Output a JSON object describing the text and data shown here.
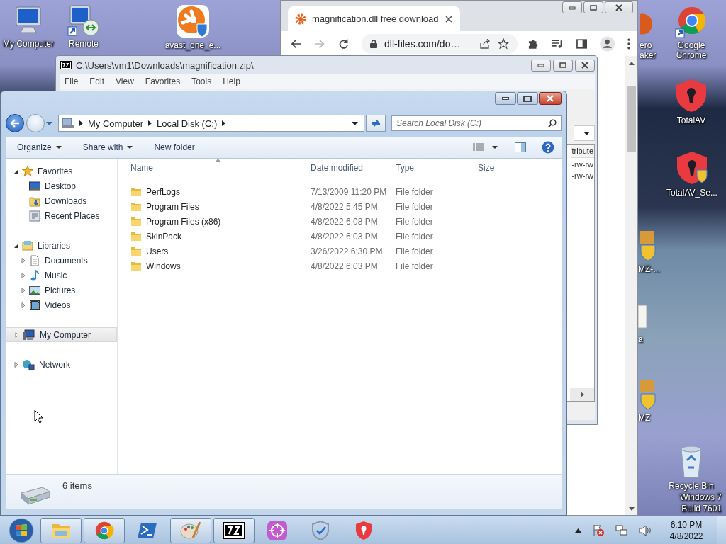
{
  "desktop": {
    "left_icons": [
      {
        "label": "My Computer",
        "kind": "computer"
      },
      {
        "label": "Remote",
        "kind": "remote"
      },
      {
        "label": "avast_one_e...",
        "kind": "avast"
      }
    ],
    "right_icons": [
      {
        "label": "ero aker",
        "kind": "partial"
      },
      {
        "label": "Google Chrome",
        "kind": "chrome"
      },
      {
        "label": "TotalAV",
        "kind": "totalav"
      },
      {
        "label": "TotalAV_Se...",
        "kind": "totalav-setup"
      },
      {
        "label": "MZ-...",
        "kind": "installer"
      },
      {
        "label": "a",
        "kind": "document"
      },
      {
        "label": "MZ",
        "kind": "installer"
      },
      {
        "label": "Recycle Bin",
        "kind": "recycle"
      }
    ],
    "os_label": [
      "Windows 7",
      "Build 7601"
    ]
  },
  "browser": {
    "tab": {
      "title": "magnification.dll free download",
      "selected": true
    },
    "address": "dll-files.com/do…"
  },
  "archive_window": {
    "title": "C:\\Users\\vm1\\Downloads\\magnification.zip\\",
    "menu": [
      "File",
      "Edit",
      "View",
      "Favorites",
      "Tools",
      "Help"
    ],
    "column_header": "tribute",
    "rows": [
      "-rw-rw",
      "-rw-rw"
    ]
  },
  "explorer": {
    "breadcrumb": [
      "My Computer",
      "Local Disk (C:)"
    ],
    "search": {
      "placeholder": "Search Local Disk (C:)"
    },
    "commands": [
      {
        "label": "Organize",
        "dropdown": true
      },
      {
        "label": "Share with",
        "dropdown": true
      },
      {
        "label": "New folder",
        "dropdown": false
      }
    ],
    "tree": [
      {
        "label": "Favorites",
        "kind": "star",
        "expanded": true,
        "selected": false,
        "children": [
          {
            "label": "Desktop",
            "kind": "desktop",
            "selected": false
          },
          {
            "label": "Downloads",
            "kind": "downloads",
            "selected": false
          },
          {
            "label": "Recent Places",
            "kind": "recent",
            "selected": false
          }
        ]
      },
      {
        "label": "Libraries",
        "kind": "library",
        "expanded": true,
        "selected": false,
        "children": [
          {
            "label": "Documents",
            "kind": "documents",
            "expanded": false,
            "selected": false
          },
          {
            "label": "Music",
            "kind": "music",
            "expanded": false,
            "selected": false
          },
          {
            "label": "Pictures",
            "kind": "pictures",
            "expanded": false,
            "selected": false
          },
          {
            "label": "Videos",
            "kind": "videos",
            "expanded": false,
            "selected": false
          }
        ]
      },
      {
        "label": "My Computer",
        "kind": "computer",
        "expanded": false,
        "selected": true
      },
      {
        "label": "Network",
        "kind": "network",
        "expanded": false,
        "selected": false
      }
    ],
    "columns": [
      "Name",
      "Date modified",
      "Type",
      "Size"
    ],
    "files": [
      {
        "name": "PerfLogs",
        "date": "7/13/2009 11:20 PM",
        "type": "File folder"
      },
      {
        "name": "Program Files",
        "date": "4/8/2022 5:45 PM",
        "type": "File folder"
      },
      {
        "name": "Program Files (x86)",
        "date": "4/8/2022 6:08 PM",
        "type": "File folder"
      },
      {
        "name": "SkinPack",
        "date": "4/8/2022 6:03 PM",
        "type": "File folder"
      },
      {
        "name": "Users",
        "date": "3/26/2022 6:30 PM",
        "type": "File folder"
      },
      {
        "name": "Windows",
        "date": "4/8/2022 6:03 PM",
        "type": "File folder"
      }
    ],
    "status": "6 items"
  },
  "taskbar": {
    "apps": [
      {
        "kind": "explorer",
        "running": true
      },
      {
        "kind": "chrome",
        "running": true
      },
      {
        "kind": "powershell",
        "running": false
      },
      {
        "kind": "paint",
        "running": true
      },
      {
        "kind": "sevenzip",
        "running": true
      },
      {
        "kind": "purple-app",
        "running": false
      },
      {
        "kind": "shield-check",
        "running": false
      },
      {
        "kind": "totalav",
        "running": false
      }
    ],
    "time": "6:10 PM",
    "date": "4/8/2022"
  }
}
